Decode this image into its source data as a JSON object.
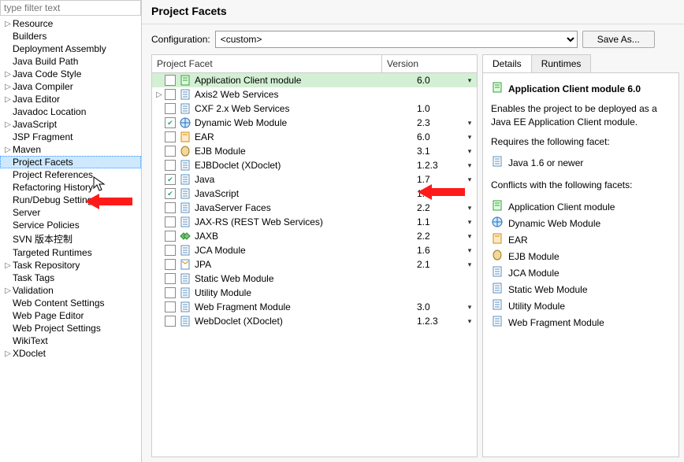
{
  "filter_placeholder": "type filter text",
  "sidebar": {
    "items": [
      {
        "label": "Resource",
        "expandable": true
      },
      {
        "label": "Builders",
        "expandable": false
      },
      {
        "label": "Deployment Assembly",
        "expandable": false
      },
      {
        "label": "Java Build Path",
        "expandable": false
      },
      {
        "label": "Java Code Style",
        "expandable": true
      },
      {
        "label": "Java Compiler",
        "expandable": true
      },
      {
        "label": "Java Editor",
        "expandable": true
      },
      {
        "label": "Javadoc Location",
        "expandable": false
      },
      {
        "label": "JavaScript",
        "expandable": true
      },
      {
        "label": "JSP Fragment",
        "expandable": false
      },
      {
        "label": "Maven",
        "expandable": true
      },
      {
        "label": "Project Facets",
        "expandable": false,
        "selected": true
      },
      {
        "label": "Project References",
        "expandable": false
      },
      {
        "label": "Refactoring History",
        "expandable": false
      },
      {
        "label": "Run/Debug Settings",
        "expandable": false
      },
      {
        "label": "Server",
        "expandable": false
      },
      {
        "label": "Service Policies",
        "expandable": false
      },
      {
        "label": "SVN 版本控制",
        "expandable": false
      },
      {
        "label": "Targeted Runtimes",
        "expandable": false
      },
      {
        "label": "Task Repository",
        "expandable": true
      },
      {
        "label": "Task Tags",
        "expandable": false
      },
      {
        "label": "Validation",
        "expandable": true
      },
      {
        "label": "Web Content Settings",
        "expandable": false
      },
      {
        "label": "Web Page Editor",
        "expandable": false
      },
      {
        "label": "Web Project Settings",
        "expandable": false
      },
      {
        "label": "WikiText",
        "expandable": false
      },
      {
        "label": "XDoclet",
        "expandable": true
      }
    ]
  },
  "title": "Project Facets",
  "config_label": "Configuration:",
  "config_value": "<custom>",
  "save_as_label": "Save As...",
  "cols": {
    "facet": "Project Facet",
    "version": "Version"
  },
  "facets": [
    {
      "name": "Application Client module",
      "ver": "6.0",
      "checked": false,
      "dd": true,
      "icon": "doc-green",
      "expandable": false,
      "sel": true
    },
    {
      "name": "Axis2 Web Services",
      "ver": "",
      "checked": false,
      "dd": false,
      "icon": "doc",
      "expandable": true
    },
    {
      "name": "CXF 2.x Web Services",
      "ver": "1.0",
      "checked": false,
      "dd": false,
      "icon": "doc"
    },
    {
      "name": "Dynamic Web Module",
      "ver": "2.3",
      "checked": true,
      "dd": true,
      "icon": "globe"
    },
    {
      "name": "EAR",
      "ver": "6.0",
      "checked": false,
      "dd": true,
      "icon": "doc-orange"
    },
    {
      "name": "EJB Module",
      "ver": "3.1",
      "checked": false,
      "dd": true,
      "icon": "bean"
    },
    {
      "name": "EJBDoclet (XDoclet)",
      "ver": "1.2.3",
      "checked": false,
      "dd": true,
      "icon": "doc"
    },
    {
      "name": "Java",
      "ver": "1.7",
      "checked": true,
      "dd": true,
      "icon": "doc"
    },
    {
      "name": "JavaScript",
      "ver": "1.0",
      "checked": true,
      "dd": false,
      "icon": "doc"
    },
    {
      "name": "JavaServer Faces",
      "ver": "2.2",
      "checked": false,
      "dd": true,
      "icon": "doc"
    },
    {
      "name": "JAX-RS (REST Web Services)",
      "ver": "1.1",
      "checked": false,
      "dd": true,
      "icon": "doc"
    },
    {
      "name": "JAXB",
      "ver": "2.2",
      "checked": false,
      "dd": true,
      "icon": "jaxb"
    },
    {
      "name": "JCA Module",
      "ver": "1.6",
      "checked": false,
      "dd": true,
      "icon": "doc"
    },
    {
      "name": "JPA",
      "ver": "2.1",
      "checked": false,
      "dd": true,
      "icon": "jpa"
    },
    {
      "name": "Static Web Module",
      "ver": "",
      "checked": false,
      "dd": false,
      "icon": "doc"
    },
    {
      "name": "Utility Module",
      "ver": "",
      "checked": false,
      "dd": false,
      "icon": "doc"
    },
    {
      "name": "Web Fragment Module",
      "ver": "3.0",
      "checked": false,
      "dd": true,
      "icon": "doc"
    },
    {
      "name": "WebDoclet (XDoclet)",
      "ver": "1.2.3",
      "checked": false,
      "dd": true,
      "icon": "doc"
    }
  ],
  "tabs": {
    "details": "Details",
    "runtimes": "Runtimes"
  },
  "detail": {
    "heading": "Application Client module 6.0",
    "desc": "Enables the project to be deployed as a Java EE Application Client module.",
    "req_label": "Requires the following facet:",
    "req": [
      {
        "name": "Java 1.6 or newer",
        "icon": "doc"
      }
    ],
    "conf_label": "Conflicts with the following facets:",
    "conf": [
      {
        "name": "Application Client module",
        "icon": "doc-green"
      },
      {
        "name": "Dynamic Web Module",
        "icon": "globe"
      },
      {
        "name": "EAR",
        "icon": "doc-orange"
      },
      {
        "name": "EJB Module",
        "icon": "bean"
      },
      {
        "name": "JCA Module",
        "icon": "doc"
      },
      {
        "name": "Static Web Module",
        "icon": "doc"
      },
      {
        "name": "Utility Module",
        "icon": "doc"
      },
      {
        "name": "Web Fragment Module",
        "icon": "doc"
      }
    ]
  }
}
